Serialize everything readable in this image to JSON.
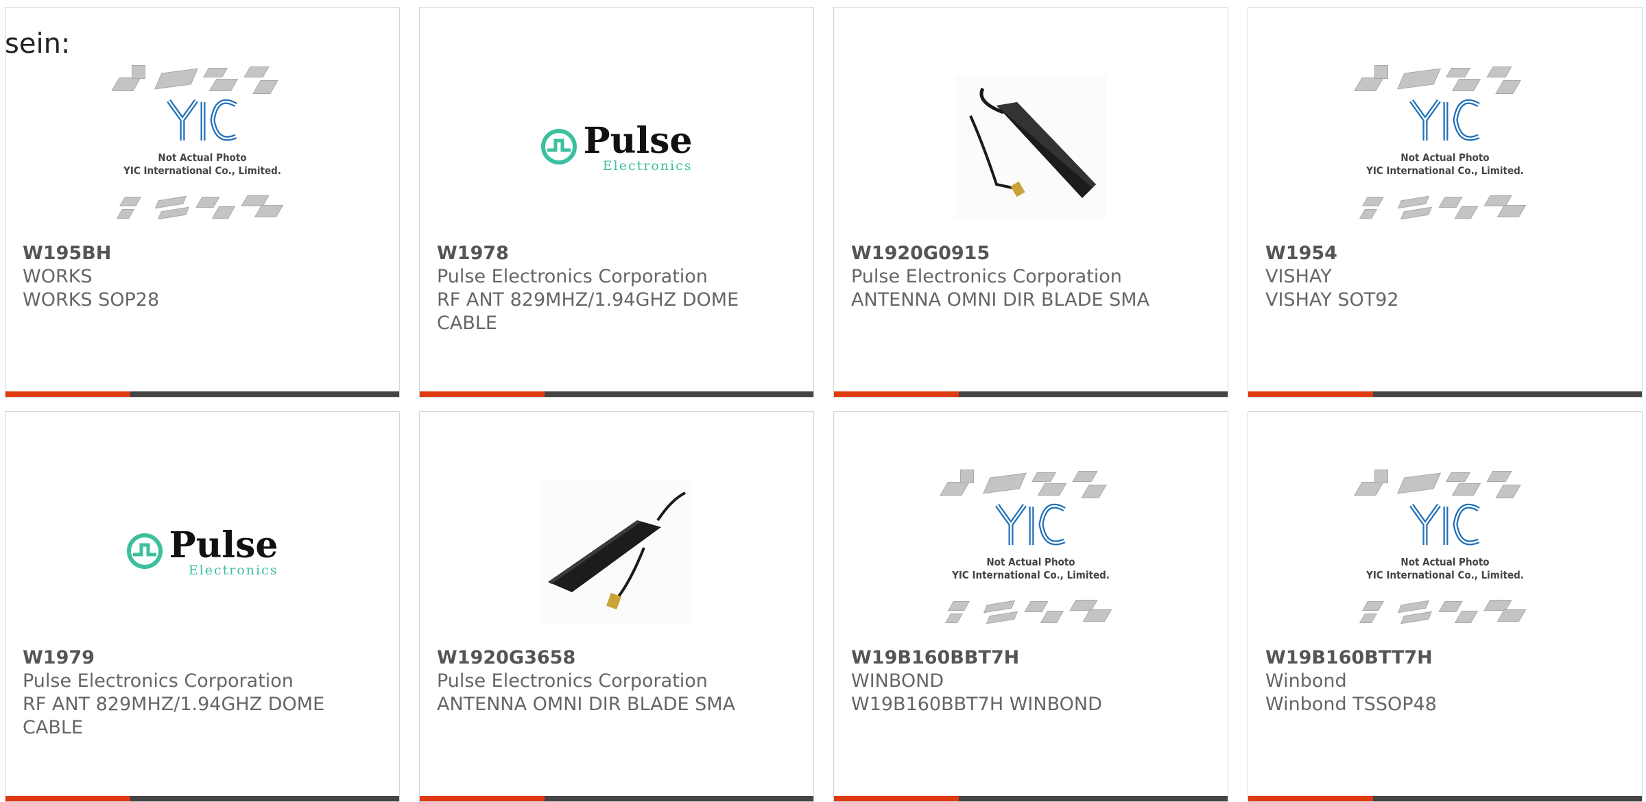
{
  "intro_text": "sein:",
  "placeholder": {
    "logo": "YIC",
    "line1": "Not Actual Photo",
    "line2": "YIC International Co., Limited."
  },
  "pulse_logo": {
    "word": "Pulse",
    "sub": "Electronics"
  },
  "colors": {
    "accent": "#e03a12",
    "bar": "#444444",
    "pulse_green": "#3dbf9f",
    "yic_blue": "#1e6fb8"
  },
  "products": [
    {
      "part": "W195BH",
      "manufacturer": "WORKS",
      "description": "WORKS SOP28",
      "image": "yic-placeholder"
    },
    {
      "part": "W1978",
      "manufacturer": "Pulse Electronics Corporation",
      "description": "RF ANT 829MHZ/1.94GHZ DOME CABLE",
      "image": "pulse-logo"
    },
    {
      "part": "W1920G0915",
      "manufacturer": "Pulse Electronics Corporation",
      "description": "ANTENNA OMNI DIR BLADE SMA",
      "image": "blade-antenna"
    },
    {
      "part": "W1954",
      "manufacturer": "VISHAY",
      "description": "VISHAY SOT92",
      "image": "yic-placeholder"
    },
    {
      "part": "W1979",
      "manufacturer": "Pulse Electronics Corporation",
      "description": "RF ANT 829MHZ/1.94GHZ DOME CABLE",
      "image": "pulse-logo"
    },
    {
      "part": "W1920G3658",
      "manufacturer": "Pulse Electronics Corporation",
      "description": "ANTENNA OMNI DIR BLADE SMA",
      "image": "blade-antenna"
    },
    {
      "part": "W19B160BBT7H",
      "manufacturer": "WINBOND",
      "description": "W19B160BBT7H WINBOND",
      "image": "yic-placeholder"
    },
    {
      "part": "W19B160BTT7H",
      "manufacturer": "Winbond",
      "description": "Winbond TSSOP48",
      "image": "yic-placeholder"
    }
  ]
}
